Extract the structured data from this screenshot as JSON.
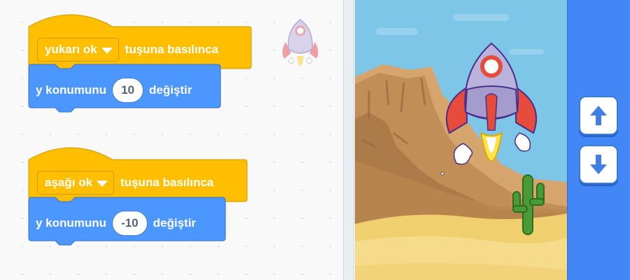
{
  "scripts": [
    {
      "hat": {
        "key": "yukarı ok",
        "label": "tuşuna basılınca"
      },
      "action": {
        "prefix": "y konumunu",
        "value": "10",
        "suffix": "değiştir"
      }
    },
    {
      "hat": {
        "key": "aşağı ok",
        "label": "tuşuna basılınca"
      },
      "action": {
        "prefix": "y konumunu",
        "value": "-10",
        "suffix": "değiştir"
      }
    }
  ],
  "stage": {
    "sprite": "rocket",
    "backdrop": "desert",
    "controls": [
      {
        "name": "up-arrow-button",
        "icon": "arrow-up-icon"
      },
      {
        "name": "down-arrow-button",
        "icon": "arrow-down-icon"
      }
    ]
  },
  "colors": {
    "events": "#ffbf00",
    "events_border": "#cc9900",
    "motion": "#4c97ff",
    "motion_border": "#3373cc",
    "controls_panel": "#4287f5"
  }
}
